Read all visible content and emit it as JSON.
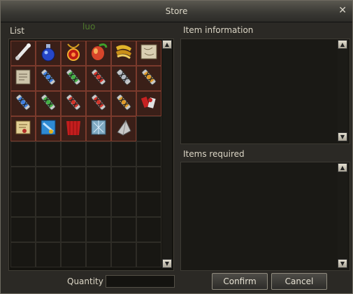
{
  "window": {
    "title": "Store",
    "close_glyph": "✕"
  },
  "list": {
    "label": "List",
    "overlay_text": "luo",
    "items": [
      {
        "icon": "bone-icon"
      },
      {
        "icon": "blue-potion-icon"
      },
      {
        "icon": "red-amulet-icon"
      },
      {
        "icon": "fire-fruit-icon"
      },
      {
        "icon": "golden-wings-icon"
      },
      {
        "icon": "map-scroll-icon"
      },
      {
        "icon": "scroll-icon"
      },
      {
        "icon": "blue-vial-icon"
      },
      {
        "icon": "green-vial-icon"
      },
      {
        "icon": "red-vial-icon"
      },
      {
        "icon": "silver-vial-icon"
      },
      {
        "icon": "orange-vial-icon"
      },
      {
        "icon": "blue-vial-icon"
      },
      {
        "icon": "green-vial-icon"
      },
      {
        "icon": "red-vial-icon"
      },
      {
        "icon": "red-vial-icon"
      },
      {
        "icon": "orange-vial-icon"
      },
      {
        "icon": "red-bundle-icon"
      },
      {
        "icon": "parchment-icon"
      },
      {
        "icon": "blue-scroll-icon"
      },
      {
        "icon": "red-cloth-icon"
      },
      {
        "icon": "ice-crystal-icon"
      },
      {
        "icon": "silver-shard-icon"
      }
    ]
  },
  "info": {
    "label": "Item information"
  },
  "required": {
    "label": "Items required"
  },
  "quantity": {
    "label": "Quantity",
    "value": ""
  },
  "buttons": {
    "confirm": "Confirm",
    "cancel": "Cancel"
  },
  "scroll": {
    "up": "▲",
    "down": "▼"
  },
  "colors": {
    "window_bg": "#2b2925",
    "cell_filled": "#3a1f18",
    "cell_border": "#7a3a2c"
  }
}
